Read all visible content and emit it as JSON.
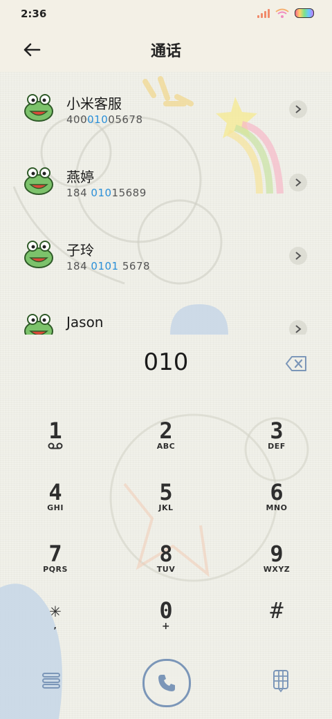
{
  "status": {
    "time": "2:36"
  },
  "header": {
    "title": "通话",
    "back_icon": "arrow-left-icon"
  },
  "contacts": [
    {
      "name": "小米客服",
      "num_parts": [
        "400",
        "010",
        "05678"
      ]
    },
    {
      "name": "燕婷",
      "num_parts": [
        "184 ",
        "010",
        "15689"
      ]
    },
    {
      "name": "子玲",
      "num_parts": [
        "184 ",
        "0101",
        " 5678"
      ]
    },
    {
      "name": "Jason",
      "num_parts": [
        "",
        "",
        ""
      ]
    }
  ],
  "dialer": {
    "number": "010",
    "keys": [
      {
        "digit": "1",
        "letters": ""
      },
      {
        "digit": "2",
        "letters": "ABC"
      },
      {
        "digit": "3",
        "letters": "DEF"
      },
      {
        "digit": "4",
        "letters": "GHI"
      },
      {
        "digit": "5",
        "letters": "JKL"
      },
      {
        "digit": "6",
        "letters": "MNO"
      },
      {
        "digit": "7",
        "letters": "PQRS"
      },
      {
        "digit": "8",
        "letters": "TUV"
      },
      {
        "digit": "9",
        "letters": "WXYZ"
      },
      {
        "digit": "✳",
        "letters": ","
      },
      {
        "digit": "0",
        "letters": "+"
      },
      {
        "digit": "#",
        "letters": ""
      }
    ]
  },
  "colors": {
    "highlight": "#2a8fd8",
    "accent": "#7b96b8",
    "background": "#eeeee6",
    "header_bg": "#f3f0e6"
  },
  "icons": {
    "menu": "menu-lines-icon",
    "call": "phone-icon",
    "keypad": "keypad-grid-icon",
    "backspace": "backspace-icon",
    "voicemail": "voicemail-icon",
    "chevron": "chevron-right-icon"
  }
}
